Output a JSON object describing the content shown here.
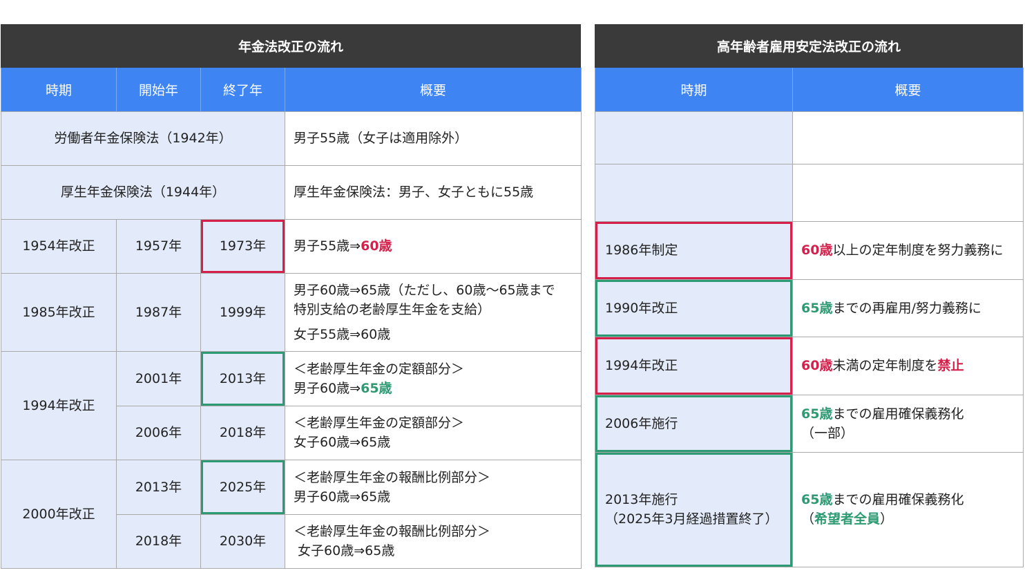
{
  "pension": {
    "title": "年金法改正の流れ",
    "headers": [
      "時期",
      "開始年",
      "終了年",
      "概要"
    ],
    "rows": {
      "r1": {
        "period": "労働者年金保険法（1942年）",
        "desc": "男子55歳（女子は適用除外）"
      },
      "r2": {
        "period": "厚生年金保険法（1944年）",
        "desc": "厚生年金保険法：男子、女子ともに55歳"
      },
      "r3": {
        "period": "1954年改正",
        "start": "1957年",
        "end": "1973年",
        "desc_a": "男子55歳⇒",
        "desc_b": "60歳"
      },
      "r4": {
        "period": "1985年改正",
        "start": "1987年",
        "end": "1999年",
        "desc1": "男子60歳⇒65歳（ただし、60歳～65歳まで",
        "desc2": "特別支給の老齢厚生年金を支給）",
        "desc3": "女子55歳⇒60歳"
      },
      "r5": {
        "period": "1994年改正",
        "start": "2001年",
        "end": "2013年",
        "desc1": "＜老齢厚生年金の定額部分＞",
        "desc2a": "男子60歳⇒",
        "desc2b": "65歳"
      },
      "r6": {
        "start": "2006年",
        "end": "2018年",
        "desc1": "＜老齢厚生年金の定額部分＞",
        "desc2": "女子60歳⇒65歳"
      },
      "r7": {
        "period": "2000年改正",
        "start": "2013年",
        "end": "2025年",
        "desc1": "＜老齢厚生年金の報酬比例部分＞",
        "desc2": "男子60歳⇒65歳"
      },
      "r8": {
        "start": "2018年",
        "end": "2030年",
        "desc1": "＜老齢厚生年金の報酬比例部分＞",
        "desc2": " 女子60歳⇒65歳"
      }
    }
  },
  "employment": {
    "title": "高年齢者雇用安定法改正の流れ",
    "headers": [
      "時期",
      "概要"
    ],
    "rows": {
      "r3": {
        "period": "1986年制定",
        "desc_a": "60歳",
        "desc_b": "以上の定年制度を努力義務に"
      },
      "r4": {
        "period": "1990年改正",
        "desc_a": "65歳",
        "desc_b": "までの再雇用/努力義務に"
      },
      "r5": {
        "period": "1994年改正",
        "desc_a": "60歳",
        "desc_b": "未満の定年制度を",
        "desc_c": "禁止"
      },
      "r6": {
        "period": "2006年施行",
        "desc_a": "65歳",
        "desc_b": "までの雇用確保義務化",
        "desc2": "（一部）"
      },
      "r7": {
        "period1": "2013年施行",
        "period2": "（2025年3月経過措置終了）",
        "desc_a": "65歳",
        "desc_b": "までの雇用確保義務化",
        "desc2a": "（",
        "desc2b": "希望者全員",
        "desc2c": "）"
      }
    }
  },
  "colors": {
    "banner": "#3a3a3a",
    "header": "#3f84f3",
    "cell": "#e3ebfa",
    "red": "#d4204a",
    "green": "#2e9a73"
  }
}
